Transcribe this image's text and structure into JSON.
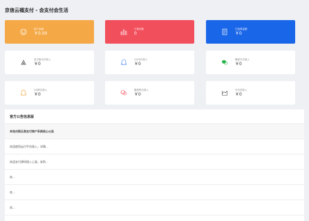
{
  "header": {
    "title": "京信云福支付 - 会支付会生活"
  },
  "stats": [
    {
      "label": "用户余额",
      "value": "￥0.00",
      "icon": "smile-icon",
      "variant": "orange"
    },
    {
      "label": "订单总数",
      "value": "0",
      "icon": "bar-chart-icon",
      "variant": "red"
    },
    {
      "label": "已结算金额",
      "value": "￥0",
      "icon": "document-icon",
      "variant": "blue"
    },
    {
      "label": "支付宝今日收入",
      "value": "￥0",
      "icon": "alipay-icon",
      "variant": "white"
    },
    {
      "label": "QQ今日收入",
      "value": "￥0",
      "icon": "qq-icon",
      "variant": "white"
    },
    {
      "label": "微信今日收入",
      "value": "￥0",
      "icon": "wechat-icon",
      "variant": "white"
    },
    {
      "label": "QQ昨日收入",
      "value": "￥0",
      "icon": "qq-outline-icon",
      "variant": "white"
    },
    {
      "label": "微信昨日收入",
      "value": "￥0",
      "icon": "wechat-outline-icon",
      "variant": "white"
    },
    {
      "label": "今日总收入",
      "value": "￥0",
      "icon": "line-chart-icon",
      "variant": "white"
    }
  ],
  "notice": {
    "title": "官方公告信息版",
    "items": [
      "本站对接云易支付商户系统核心公告",
      "欢迎使用云付平台接入，详情...",
      "欢迎支付源码接入上架，安防...",
      "欢...",
      "欢...",
      "欢..."
    ]
  },
  "colors": {
    "orange": "#f4a946",
    "red": "#f24f5d",
    "blue": "#1a66e8",
    "background": "#eef0f4"
  }
}
